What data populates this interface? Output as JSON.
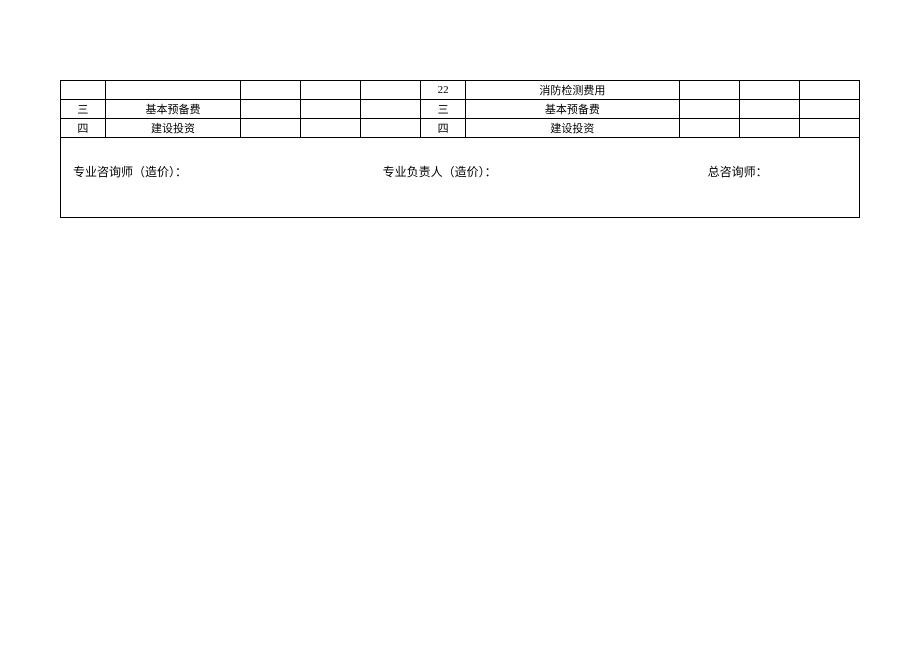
{
  "table": {
    "rows": [
      {
        "left_index": "",
        "left_name": "",
        "left_v1": "",
        "left_v2": "",
        "left_v3": "",
        "right_index": "22",
        "right_name": "消防检测费用",
        "right_v1": "",
        "right_v2": "",
        "right_v3": ""
      },
      {
        "left_index": "三",
        "left_name": "基本预备费",
        "left_v1": "",
        "left_v2": "",
        "left_v3": "",
        "right_index": "三",
        "right_name": "基本预备费",
        "right_v1": "",
        "right_v2": "",
        "right_v3": ""
      },
      {
        "left_index": "四",
        "left_name": "建设投资",
        "left_v1": "",
        "left_v2": "",
        "left_v3": "",
        "right_index": "四",
        "right_name": "建设投资",
        "right_v1": "",
        "right_v2": "",
        "right_v3": ""
      }
    ]
  },
  "signatures": {
    "field1_label": "专业咨询师（造价）：",
    "field2_label": "专业负责人（造价）：",
    "field3_label": "总咨询师："
  }
}
